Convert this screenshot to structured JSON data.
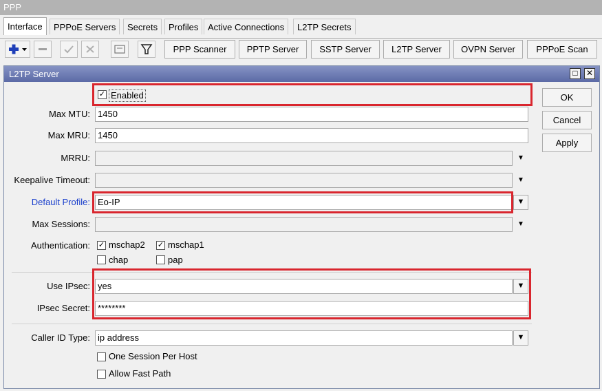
{
  "window_title": "PPP",
  "tabs": [
    "Interface",
    "PPPoE Servers",
    "Secrets",
    "Profiles",
    "Active Connections",
    "L2TP Secrets"
  ],
  "toolbar": {
    "icons": [
      "add-icon",
      "remove-icon",
      "enable-icon",
      "disable-icon",
      "comment-icon",
      "filter-icon"
    ],
    "buttons": [
      "PPP Scanner",
      "PPTP Server",
      "SSTP Server",
      "L2TP Server",
      "OVPN Server",
      "PPPoE Scan"
    ]
  },
  "dialog": {
    "title": "L2TP Server",
    "enabled_label": "Enabled",
    "buttons": {
      "ok": "OK",
      "cancel": "Cancel",
      "apply": "Apply"
    },
    "labels": {
      "max_mtu": "Max MTU:",
      "max_mru": "Max MRU:",
      "mrru": "MRRU:",
      "keepalive": "Keepalive Timeout:",
      "default_profile": "Default Profile:",
      "max_sessions": "Max Sessions:",
      "authentication": "Authentication:",
      "use_ipsec": "Use IPsec:",
      "ipsec_secret": "IPsec Secret:",
      "caller_id_type": "Caller ID Type:"
    },
    "values": {
      "max_mtu": "1450",
      "max_mru": "1450",
      "mrru": "",
      "keepalive": "",
      "default_profile": "Eo-IP",
      "max_sessions": "",
      "use_ipsec": "yes",
      "ipsec_secret": "********",
      "caller_id_type": "ip address"
    },
    "auth": {
      "mschap2": "mschap2",
      "mschap1": "mschap1",
      "chap": "chap",
      "pap": "pap"
    },
    "checkboxes": {
      "one_session": "One Session Per Host",
      "fast_path": "Allow Fast Path"
    }
  },
  "colors": {
    "highlight": "#d9262e",
    "link_label": "#1a3fcc",
    "title_bar": "#6b79b3"
  }
}
